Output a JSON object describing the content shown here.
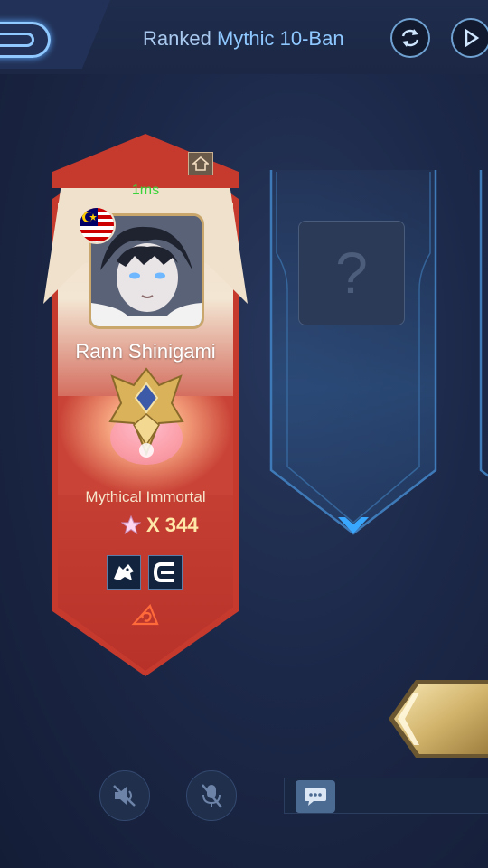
{
  "header": {
    "mode_prefix": "Ranked ",
    "mode_highlight": "Mythic 10-Ban",
    "back_icon": "back-icon",
    "refresh_icon": "refresh-icon",
    "play_icon": "play-icon"
  },
  "player": {
    "ping": "1ms",
    "name": "Rann Shinigami",
    "rank": "Mythical Immortal",
    "stars_label": "X 344",
    "country_flag_icon": "malaysia-flag-icon",
    "home_icon": "home-icon",
    "emblem_icon": "leaf-village-icon",
    "badges": [
      "wolf-badge-icon",
      "e-badge-icon"
    ]
  },
  "slots": {
    "unknown_symbol": "?"
  },
  "footer": {
    "speaker_icon": "speaker-muted-icon",
    "mic_icon": "mic-muted-icon",
    "chat_icon": "chat-icon"
  }
}
